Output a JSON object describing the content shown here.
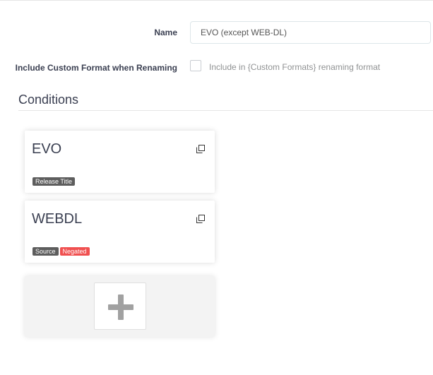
{
  "form": {
    "name_label": "Name",
    "name_value": "EVO (except WEB-DL)",
    "include_label": "Include Custom Format when Renaming",
    "include_checked": false,
    "include_help": "Include in {Custom Formats} renaming format"
  },
  "conditions": {
    "title": "Conditions",
    "items": [
      {
        "name": "EVO",
        "tags": [
          {
            "label": "Release Title",
            "kind": "default",
            "color": "#5d5d5d"
          }
        ]
      },
      {
        "name": "WEBDL",
        "tags": [
          {
            "label": "Source",
            "kind": "default",
            "color": "#5d5d5d"
          },
          {
            "label": "Negated",
            "kind": "danger",
            "color": "#f05050"
          }
        ]
      }
    ],
    "add_icon": "plus-icon",
    "clone_icon": "clone-icon"
  },
  "colors": {
    "danger": "#f05050",
    "tag_default": "#5d5d5d",
    "text": "#3a3f51",
    "help_text": "#909293"
  }
}
